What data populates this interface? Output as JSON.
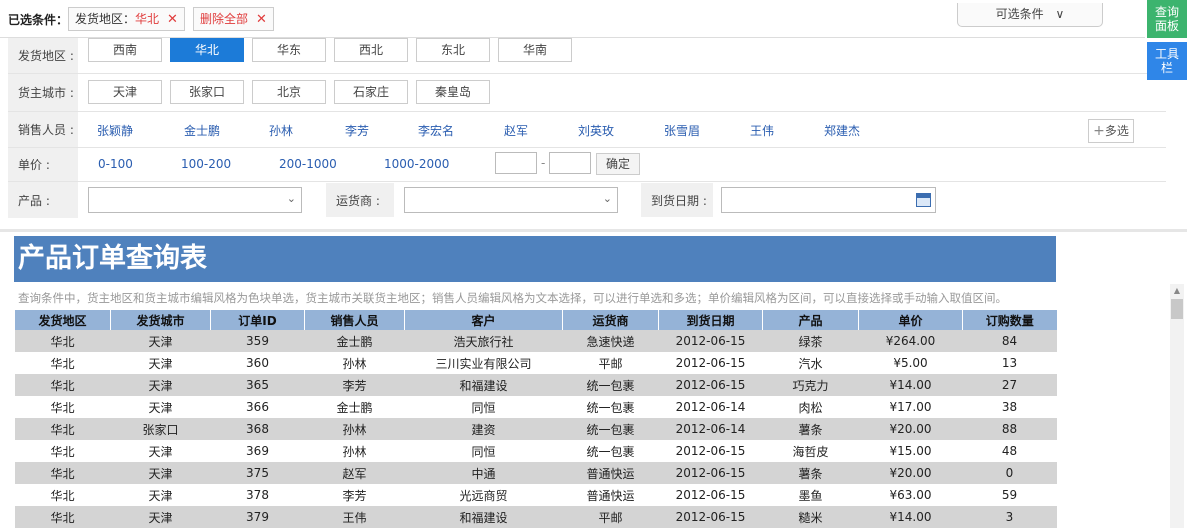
{
  "selected": {
    "title": "已选条件：",
    "tag_region_label": "发货地区：",
    "tag_region_value": "华北",
    "remove_all": "删除全部",
    "close_glyph": "✕",
    "optional_conditions": "可选条件",
    "optional_arrow": "∨"
  },
  "side": {
    "query_panel": "查询面板",
    "toolbar": "工具栏",
    "query_color": "#3cb46e",
    "toolbar_color": "#2f86e8"
  },
  "filters": {
    "region": {
      "label": "发货地区 :",
      "options": [
        "西南",
        "华北",
        "华东",
        "西北",
        "东北",
        "华南"
      ],
      "selected": "华北"
    },
    "city": {
      "label": "货主城市 :",
      "options": [
        "天津",
        "张家口",
        "北京",
        "石家庄",
        "秦皇岛"
      ]
    },
    "sales": {
      "label": "销售人员 :",
      "options": [
        "张颖静",
        "金士鹏",
        "孙林",
        "李芳",
        "李宏名",
        "赵军",
        "刘英玫",
        "张雪眉",
        "王伟",
        "郑建杰"
      ],
      "multi": "多选",
      "multi_icon": "+"
    },
    "price": {
      "label": "单价 :",
      "options": [
        "0-100",
        "100-200",
        "200-1000",
        "1000-2000"
      ],
      "dash": "-",
      "confirm": "确定"
    },
    "product": {
      "label": "产品 :"
    },
    "shipper": {
      "label": "运货商 :"
    },
    "arrive": {
      "label": "到货日期 :"
    },
    "combo_arrow": "⌄"
  },
  "report": {
    "title": "产品订单查询表",
    "description": "查询条件中，货主地区和货主城市编辑风格为色块单选，货主城市关联货主地区；销售人员编辑风格为文本选择，可以进行单选和多选；单价编辑风格为区间，可以直接选择或手动输入取值区间。",
    "columns": [
      "发货地区",
      "发货城市",
      "订单ID",
      "销售人员",
      "客户",
      "运货商",
      "到货日期",
      "产品",
      "单价",
      "订购数量"
    ],
    "rows": [
      [
        "华北",
        "天津",
        "359",
        "金士鹏",
        "浩天旅行社",
        "急速快递",
        "2012-06-15",
        "绿茶",
        "¥264.00",
        "84"
      ],
      [
        "华北",
        "天津",
        "360",
        "孙林",
        "三川实业有限公司",
        "平邮",
        "2012-06-15",
        "汽水",
        "¥5.00",
        "13"
      ],
      [
        "华北",
        "天津",
        "365",
        "李芳",
        "和福建设",
        "统一包裹",
        "2012-06-15",
        "巧克力",
        "¥14.00",
        "27"
      ],
      [
        "华北",
        "天津",
        "366",
        "金士鹏",
        "同恒",
        "统一包裹",
        "2012-06-14",
        "肉松",
        "¥17.00",
        "38"
      ],
      [
        "华北",
        "张家口",
        "368",
        "孙林",
        "建资",
        "统一包裹",
        "2012-06-14",
        "薯条",
        "¥20.00",
        "88"
      ],
      [
        "华北",
        "天津",
        "369",
        "孙林",
        "同恒",
        "统一包裹",
        "2012-06-15",
        "海哲皮",
        "¥15.00",
        "48"
      ],
      [
        "华北",
        "天津",
        "375",
        "赵军",
        "中通",
        "普通快运",
        "2012-06-15",
        "薯条",
        "¥20.00",
        "0"
      ],
      [
        "华北",
        "天津",
        "378",
        "李芳",
        "光远商贸",
        "普通快运",
        "2012-06-15",
        "墨鱼",
        "¥63.00",
        "59"
      ],
      [
        "华北",
        "天津",
        "379",
        "王伟",
        "和福建设",
        "平邮",
        "2012-06-15",
        "糙米",
        "¥14.00",
        "3"
      ]
    ]
  },
  "colors": {
    "accent": "#1c7bd8",
    "title_bar": "#4f81bd",
    "header_row": "#95b3d7",
    "remove_red": "#e03c3c"
  }
}
